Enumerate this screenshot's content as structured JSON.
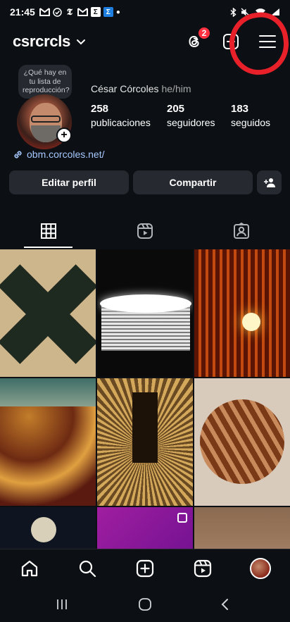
{
  "status_bar": {
    "time": "21:45",
    "notification_icons": [
      "gmail-icon",
      "checkmark-circle-icon",
      "nyt-icon",
      "gmail-icon",
      "sigma-icon",
      "sigma-icon",
      "dot-icon"
    ],
    "right_icons": [
      "bluetooth-icon",
      "mute-icon",
      "wifi-icon",
      "signal-icon"
    ]
  },
  "header": {
    "username": "csrcrcls",
    "threads_badge": "2"
  },
  "profile": {
    "note": "¿Qué hay en tu lista de reproducción?",
    "name": "César Córcoles",
    "pronouns": "he/him",
    "stats": [
      {
        "value": "258",
        "label": "publicaciones"
      },
      {
        "value": "205",
        "label": "seguidores"
      },
      {
        "value": "183",
        "label": "seguidos"
      }
    ],
    "link": "obm.corcoles.net/"
  },
  "buttons": {
    "edit": "Editar perfil",
    "share": "Compartir"
  },
  "tabs": [
    "grid-icon",
    "reels-icon",
    "tagged-icon"
  ],
  "grid": {
    "posts": [
      "x-shape-photo",
      "lamp-shade-photo",
      "bulb-photo",
      "glass-pebbles-photo",
      "lamp-light-photo",
      "glass-sphere-photo",
      "moon-photo",
      "purple-light-photo",
      "brown-photo"
    ]
  },
  "bottom_nav": [
    "home-icon",
    "search-icon",
    "add-post-icon",
    "reels-icon",
    "profile-avatar"
  ],
  "colors": {
    "background": "#0c1014",
    "badge": "#ff3040",
    "link": "#a6c8ff",
    "annotation": "#e8202a"
  }
}
